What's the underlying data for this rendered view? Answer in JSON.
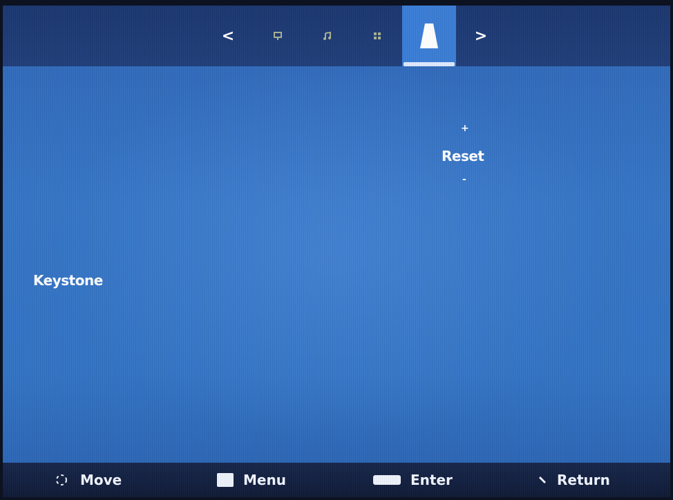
{
  "menu": {
    "tabs": [
      {
        "icon": "chevron-left-icon",
        "label": "<"
      },
      {
        "icon": "picture-icon"
      },
      {
        "icon": "music-note-icon"
      },
      {
        "icon": "grid-icon"
      },
      {
        "icon": "keystone-icon",
        "active": true
      },
      {
        "icon": "chevron-right-icon",
        "label": ">"
      }
    ]
  },
  "settings": {
    "keystone_label": "Keystone",
    "reset_label": "Reset",
    "plus_label": "+",
    "minus_label": "-"
  },
  "footer": {
    "move_label": "Move",
    "menu_label": "Menu",
    "enter_label": "Enter",
    "return_label": "Return"
  },
  "colors": {
    "background": "#3575c6",
    "topbar": "#1b3770",
    "active_tab": "#3a7dd6",
    "text": "#ffffff"
  }
}
